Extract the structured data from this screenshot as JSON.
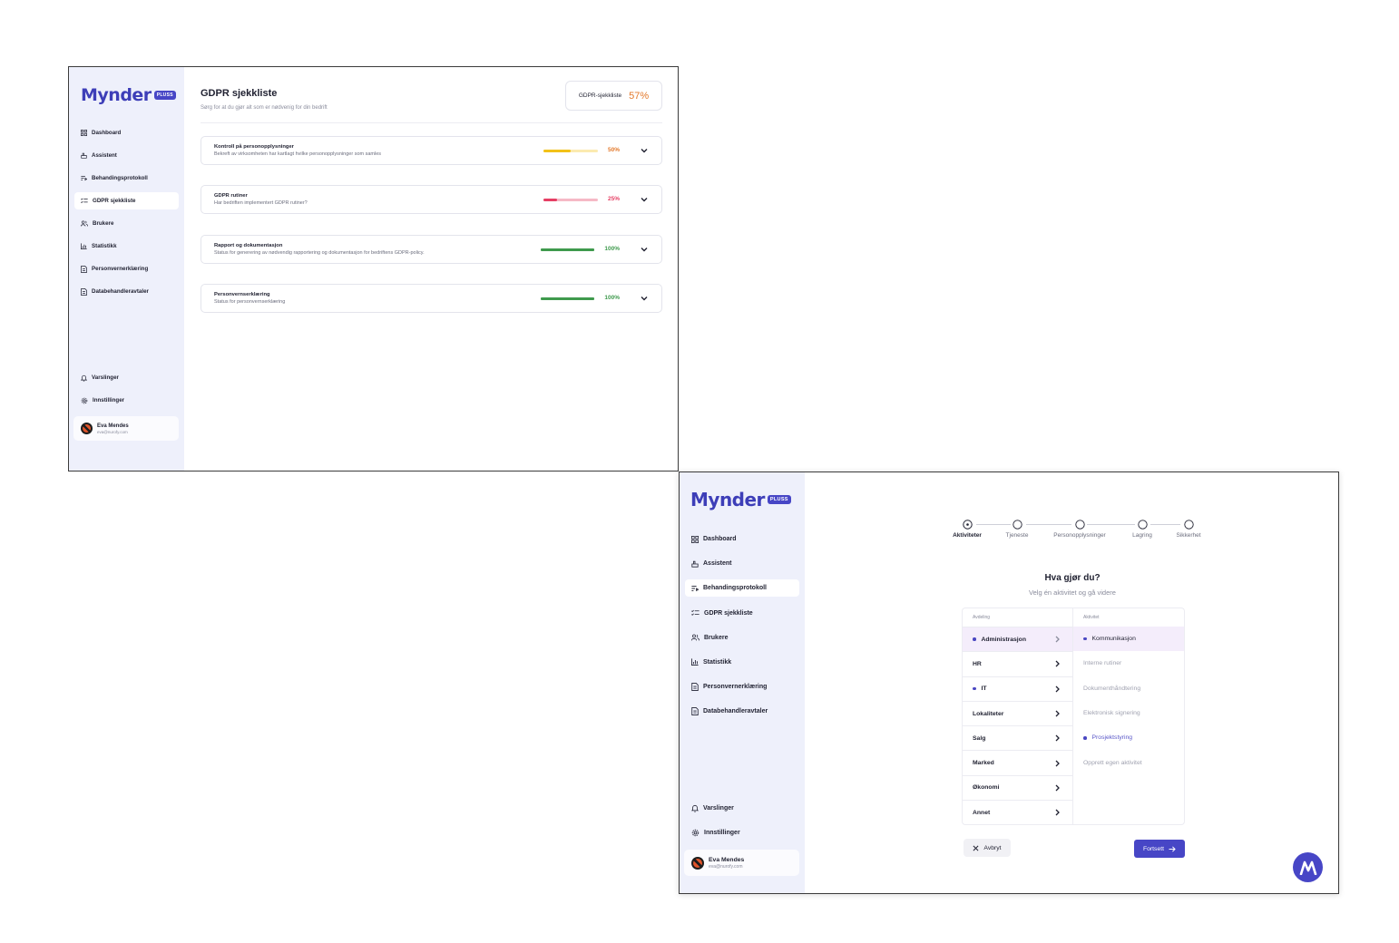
{
  "colors": {
    "brand": "#4746c6",
    "sidebar_bg": "#eef0fb",
    "progress_orange": "#e3792b",
    "bar_yellow": "#f2c118",
    "bar_red": "#e63f64",
    "bar_green": "#3f9a4d"
  },
  "brand": {
    "logo": "Mynder",
    "badge": "PLUSS"
  },
  "sidebar": {
    "items": [
      {
        "label": "Dashboard",
        "icon": "grid-icon"
      },
      {
        "label": "Assistent",
        "icon": "hand-icon"
      },
      {
        "label": "Behandingsprotokoll",
        "icon": "list-filter-icon"
      },
      {
        "label": "GDPR sjekkliste",
        "icon": "checklist-icon"
      },
      {
        "label": "Brukere",
        "icon": "users-icon"
      },
      {
        "label": "Statistikk",
        "icon": "bar-chart-icon"
      },
      {
        "label": "Personvernerklæring",
        "icon": "document-icon"
      },
      {
        "label": "Databehandleravtaler",
        "icon": "document-icon"
      }
    ],
    "bottom": [
      {
        "label": "Varslinger",
        "icon": "bell-icon"
      },
      {
        "label": "Innstillinger",
        "icon": "gear-icon"
      }
    ],
    "user": {
      "name": "Eva Mendes",
      "email": "eva@nurofy.com"
    }
  },
  "checklist_page": {
    "title": "GDPR sjekkliste",
    "subtitle": "Sørg for at du gjør alt som er nødvenig for din bedrift",
    "score_label": "GDPR-sjekkliste",
    "score_value": "57%",
    "sections": [
      {
        "title": "Kontroll på personopplysninger",
        "description": "Bekreft av virksomheten har kartlagt hvilke personopplysninger som samles",
        "progress": 0.5,
        "progress_label": "50%",
        "color": "#f2c118",
        "track": "#fbeab0",
        "text_color": "#e3792b"
      },
      {
        "title": "GDPR rutiner",
        "description": "Har bedriften implementert GDPR rutiner?",
        "progress": 0.25,
        "progress_label": "25%",
        "color": "#e63f64",
        "track": "#f6b9c6",
        "text_color": "#e63f64"
      },
      {
        "title": "Rapport og dokumentasjon",
        "description": "Status for generering av nødvendig rapportering og dokumentasjon  for bedriftens GDPR-policy.",
        "progress": 1.0,
        "progress_label": "100%",
        "color": "#3f9a4d",
        "track": "#3f9a4d",
        "text_color": "#3f9a4d"
      },
      {
        "title": "Personvernserklæring",
        "description": "Status for personvernserklæring",
        "progress": 1.0,
        "progress_label": "100%",
        "color": "#3f9a4d",
        "track": "#3f9a4d",
        "text_color": "#3f9a4d"
      }
    ]
  },
  "wizard_page": {
    "steps": [
      "Aktiviteter",
      "Tjeneste",
      "Personopplysninger",
      "Lagring",
      "Sikkerhet"
    ],
    "current_step": 0,
    "question": "Hva gjør du?",
    "question_sub": "Velg én aktivitet og gå videre",
    "col_department": "Avdeling",
    "col_activity": "Aktivitet",
    "departments": [
      {
        "label": "Administrasjon",
        "dot": true,
        "selected": true
      },
      {
        "label": "HR",
        "dot": false,
        "selected": false
      },
      {
        "label": "IT",
        "dot": true,
        "selected": false
      },
      {
        "label": "Lokaliteter",
        "dot": false,
        "selected": false
      },
      {
        "label": "Salg",
        "dot": false,
        "selected": false
      },
      {
        "label": "Marked",
        "dot": false,
        "selected": false
      },
      {
        "label": "Økonomi",
        "dot": false,
        "selected": false
      },
      {
        "label": "Annet",
        "dot": false,
        "selected": false
      }
    ],
    "activities": [
      {
        "label": "Kommunikasjon",
        "dot": true,
        "selected": true
      },
      {
        "label": "Interne rutiner",
        "dot": false,
        "selected": false
      },
      {
        "label": "Dokumenthåndtering",
        "dot": false,
        "selected": false
      },
      {
        "label": "Elektronisk signering",
        "dot": false,
        "selected": false
      },
      {
        "label": "Prosjektstyring",
        "dot": true,
        "selected": false
      },
      {
        "label": "Opprett egen aktivitet",
        "dot": false,
        "selected": false
      }
    ],
    "cancel_label": "Avbryt",
    "next_label": "Fortsett"
  }
}
